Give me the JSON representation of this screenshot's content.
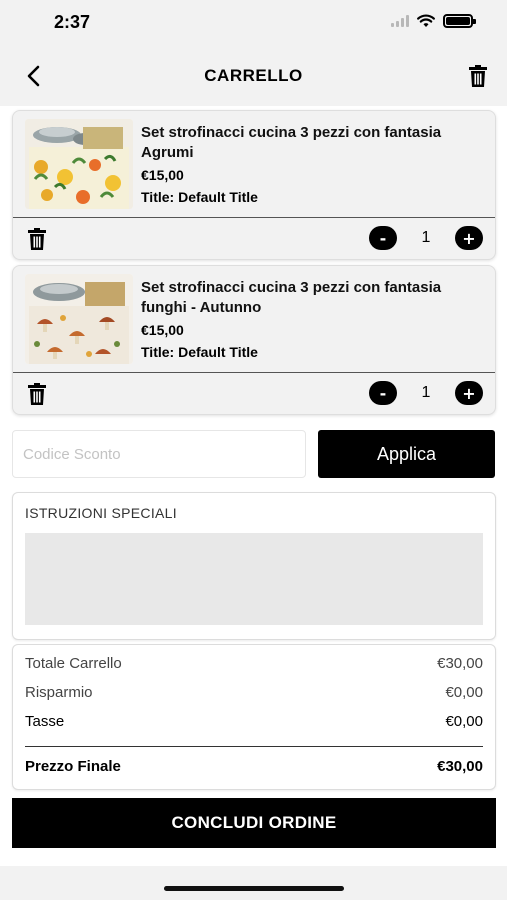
{
  "status_bar": {
    "time": "2:37",
    "icons": [
      "signal-icon",
      "wifi-icon",
      "battery-icon"
    ]
  },
  "header": {
    "title": "CARRELLO",
    "back_icon": "chevron-left-icon",
    "clear_icon": "trash-icon"
  },
  "cart": {
    "items": [
      {
        "name": "Set strofinacci cucina 3 pezzi con fantasia Agrumi",
        "price": "€15,00",
        "variant": "Title: Default Title",
        "quantity": "1",
        "decrement_label": "-",
        "increment_label": "+"
      },
      {
        "name": "Set strofinacci cucina 3 pezzi con fantasia funghi - Autunno",
        "price": "€15,00",
        "variant": "Title: Default Title",
        "quantity": "1",
        "decrement_label": "-",
        "increment_label": "+"
      }
    ]
  },
  "discount": {
    "placeholder": "Codice Sconto",
    "value": "",
    "apply_label": "Applica"
  },
  "instructions": {
    "label": "ISTRUZIONI SPECIALI",
    "value": ""
  },
  "totals": {
    "subtotal_label": "Totale Carrello",
    "subtotal_value": "€30,00",
    "savings_label": "Risparmio",
    "savings_value": "€0,00",
    "tax_label": "Tasse",
    "tax_value": "€0,00",
    "final_label": "Prezzo Finale",
    "final_value": "€30,00"
  },
  "checkout": {
    "label": "CONCLUDI ORDINE"
  },
  "colors": {
    "primary": "#000000",
    "background": "#f2f2f2",
    "input_area": "#e8e8e8"
  }
}
